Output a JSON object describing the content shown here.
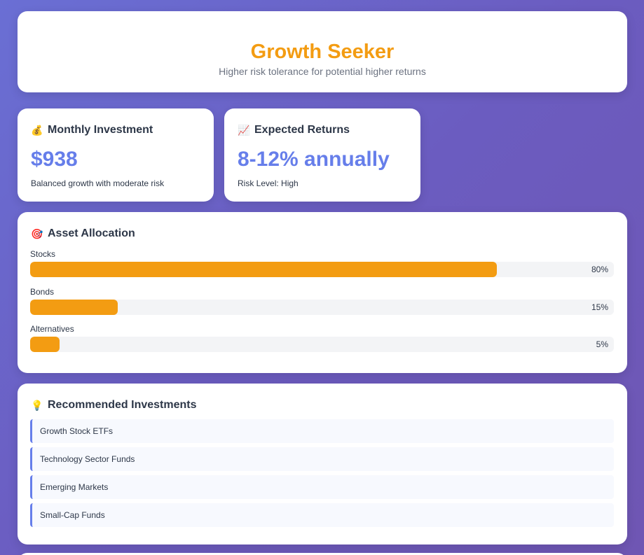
{
  "profile": {
    "title": "Growth Seeker",
    "subtitle": "Higher risk tolerance for potential higher returns"
  },
  "monthly": {
    "icon": "money-bag-icon",
    "icon_glyph": "💰",
    "heading": "Monthly Investment",
    "value": "$938",
    "note": "Balanced growth with moderate risk"
  },
  "returns": {
    "icon": "chart-increasing-icon",
    "icon_glyph": "📈",
    "heading": "Expected Returns",
    "value": "8-12% annually",
    "note": "Risk Level: High"
  },
  "allocation": {
    "icon": "target-icon",
    "icon_glyph": "🎯",
    "heading": "Asset Allocation",
    "bar_color": "#f39c12",
    "items": [
      {
        "label": "Stocks",
        "percent": 80,
        "percent_label": "80%"
      },
      {
        "label": "Bonds",
        "percent": 15,
        "percent_label": "15%"
      },
      {
        "label": "Alternatives",
        "percent": 5,
        "percent_label": "5%"
      }
    ]
  },
  "recommendations": {
    "icon": "light-bulb-icon",
    "icon_glyph": "💡",
    "heading": "Recommended Investments",
    "items": [
      {
        "label": "Growth Stock ETFs"
      },
      {
        "label": "Technology Sector Funds"
      },
      {
        "label": "Emerging Markets"
      },
      {
        "label": "Small-Cap Funds"
      }
    ]
  },
  "colors": {
    "accent": "#667eea",
    "title": "#f39c12"
  }
}
